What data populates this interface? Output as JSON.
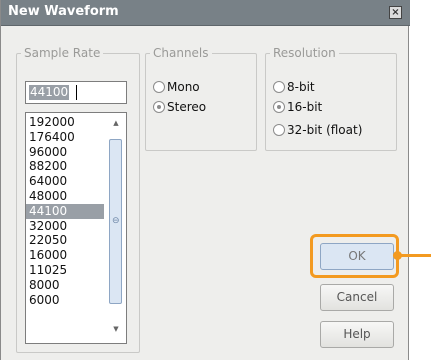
{
  "window": {
    "title": "New Waveform",
    "close_glyph": "×"
  },
  "sample_rate": {
    "legend": "Sample Rate",
    "input_value": "44100",
    "options": [
      "192000",
      "176400",
      "96000",
      "88200",
      "64000",
      "48000",
      "44100",
      "32000",
      "22050",
      "16000",
      "11025",
      "8000",
      "6000"
    ],
    "selected": "44100",
    "scroll_up": "▲",
    "scroll_down": "▼",
    "scroll_grip": "⊖"
  },
  "channels": {
    "legend": "Channels",
    "options": [
      {
        "label": "Mono",
        "checked": false
      },
      {
        "label": "Stereo",
        "checked": true
      }
    ]
  },
  "resolution": {
    "legend": "Resolution",
    "options": [
      {
        "label": "8-bit",
        "checked": false
      },
      {
        "label": "16-bit",
        "checked": true
      },
      {
        "label": "32-bit (float)",
        "checked": false
      }
    ]
  },
  "buttons": {
    "ok": "OK",
    "cancel": "Cancel",
    "help": "Help"
  },
  "colors": {
    "accent_highlight": "#f39a20",
    "selection": "#999fa6",
    "titlebar": "#788187"
  }
}
